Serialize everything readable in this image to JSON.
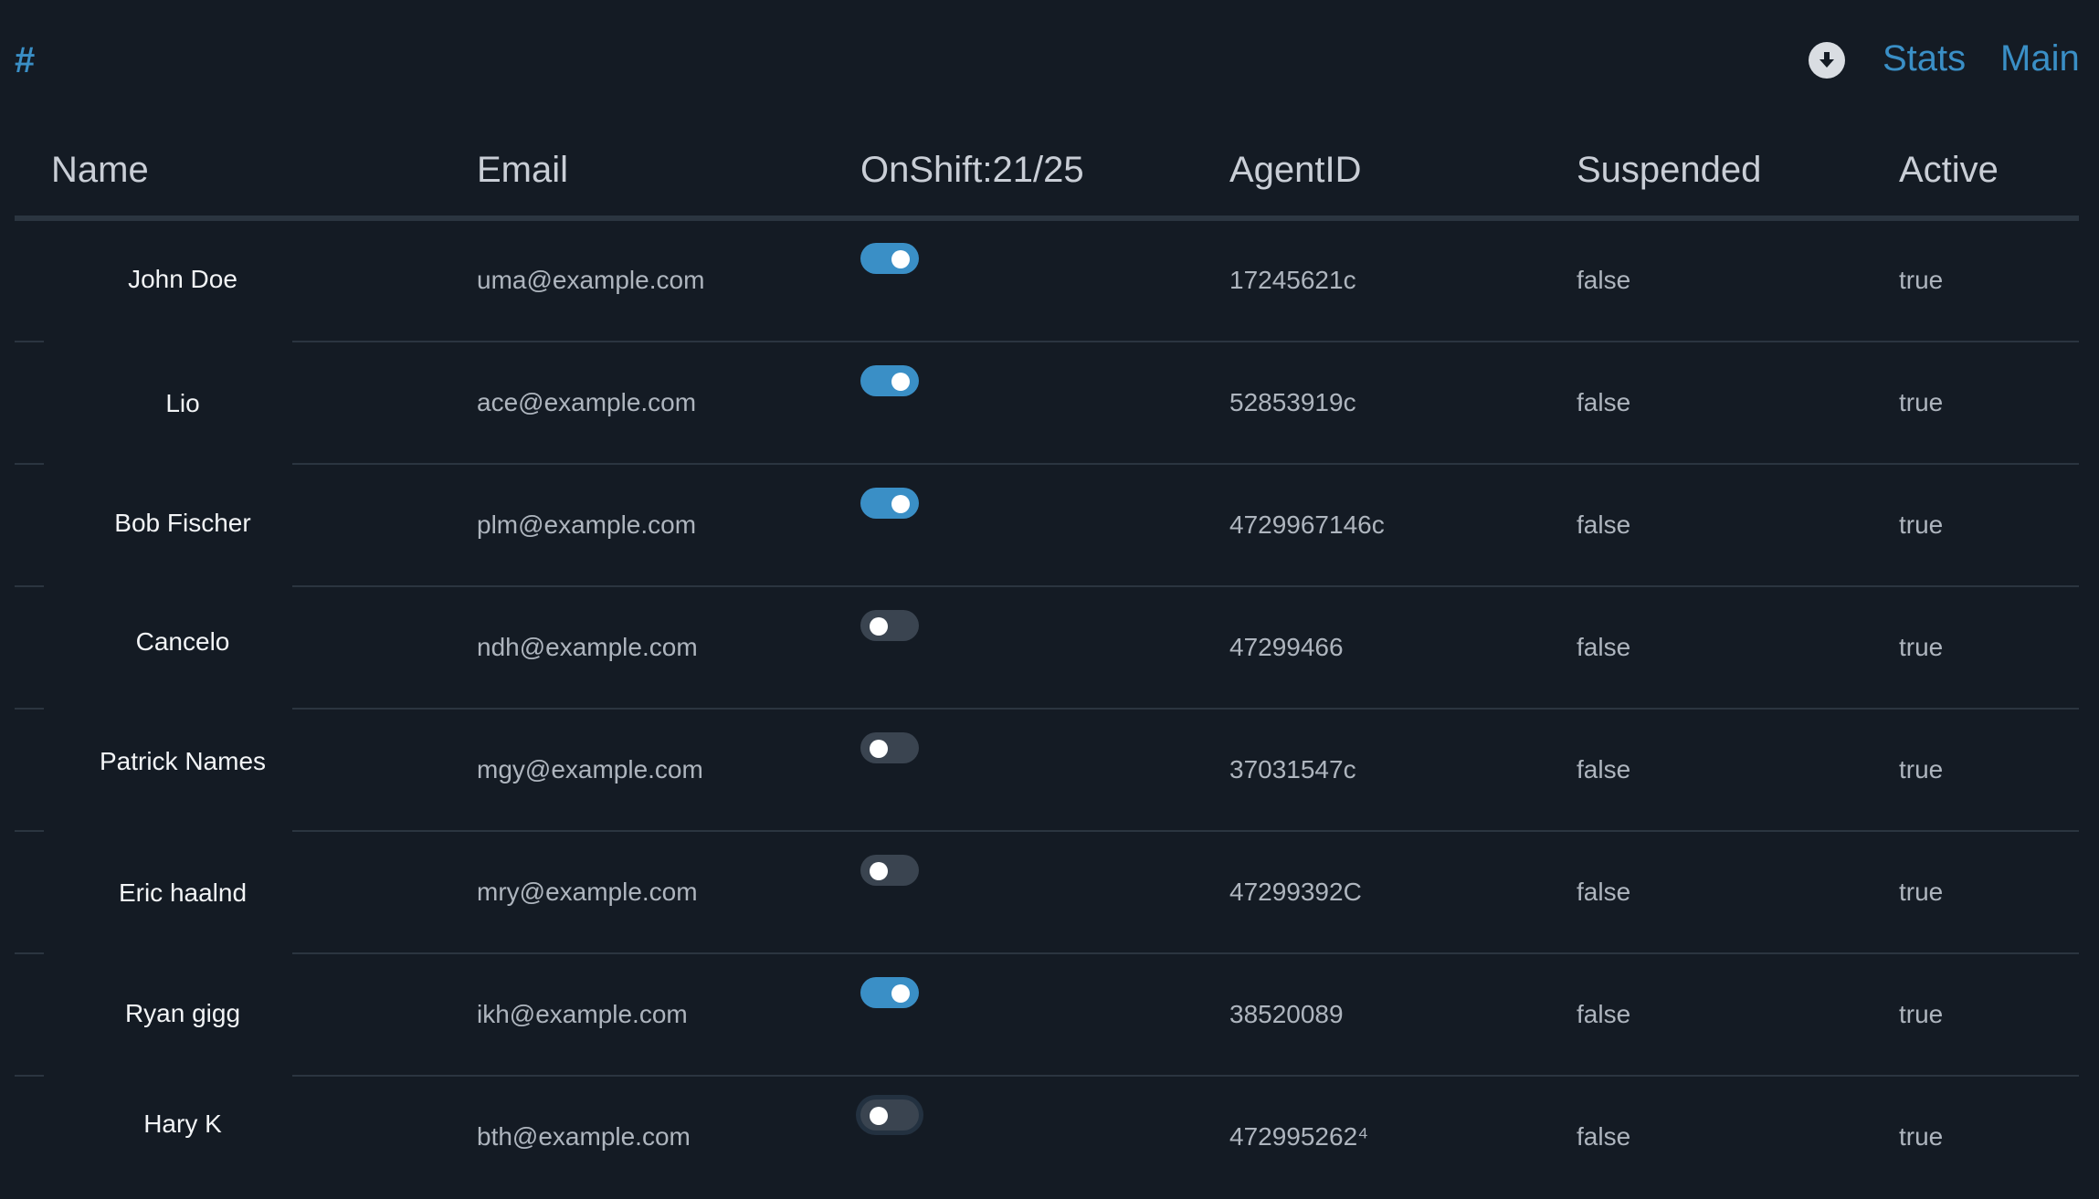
{
  "header": {
    "brand": "#",
    "nav": {
      "stats": "Stats",
      "main": "Main"
    },
    "icons": {
      "download": "download-circle-icon"
    }
  },
  "table": {
    "columns": [
      "Name",
      "Email",
      "OnShift:21/25",
      "AgentID",
      "Suspended",
      "Active"
    ],
    "rows": [
      {
        "name": "John Doe",
        "email": "uma@example.com",
        "onshift": true,
        "agent_id": "17245621с",
        "suspended": "false",
        "active": "true"
      },
      {
        "name": "Lio",
        "email": "ace@example.com",
        "onshift": true,
        "agent_id": "52853919с",
        "suspended": "false",
        "active": "true"
      },
      {
        "name": "Bob Fischer",
        "email": "plm@example.com",
        "onshift": true,
        "agent_id": "4729967146с",
        "suspended": "false",
        "active": "true"
      },
      {
        "name": "Cancelo",
        "email": "ndh@example.com",
        "onshift": false,
        "agent_id": "47299466",
        "suspended": "false",
        "active": "true"
      },
      {
        "name": "Patrick Names",
        "email": "mgy@example.com",
        "onshift": false,
        "agent_id": "37031547с",
        "suspended": "false",
        "active": "true"
      },
      {
        "name": "Eric haalnd",
        "email": "mry@example.com",
        "onshift": false,
        "agent_id": "47299392C",
        "suspended": "false",
        "active": "true"
      },
      {
        "name": "Ryan gigg",
        "email": "ikh@example.com",
        "onshift": true,
        "agent_id": "38520089",
        "suspended": "false",
        "active": "true"
      },
      {
        "name": "Hary K",
        "email": "bth@example.com",
        "onshift": false,
        "agent_id": "472995262⁴",
        "suspended": "false",
        "active": "true"
      }
    ]
  },
  "colors": {
    "background": "#141b24",
    "accent": "#3a8fc6",
    "toggle_off": "#3a4450",
    "divider": "#2b3540"
  }
}
